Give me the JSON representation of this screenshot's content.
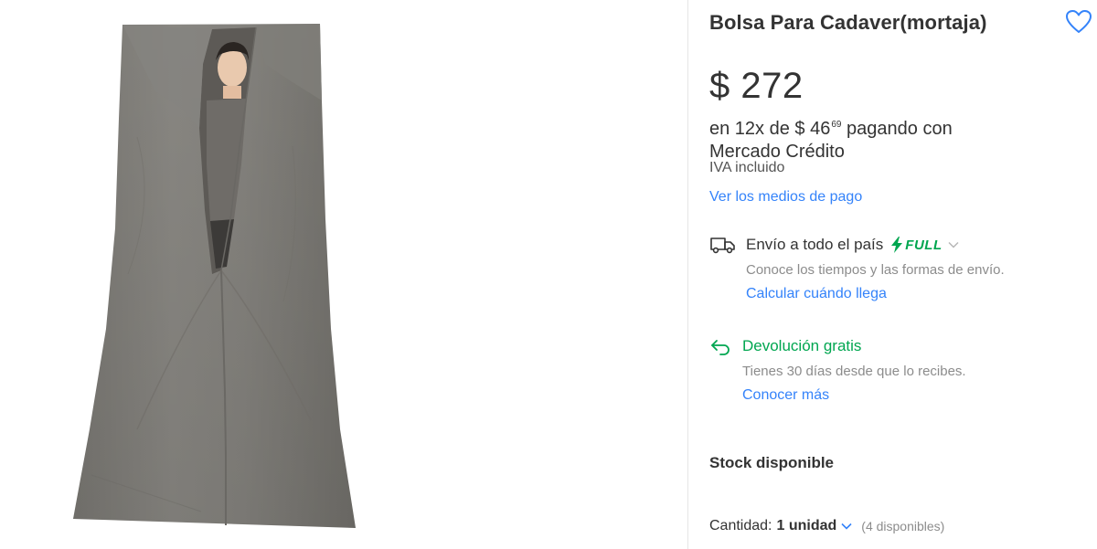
{
  "product": {
    "title": "Bolsa Para Cadaver(mortaja)",
    "image_icon": "body-bag-photo"
  },
  "price": {
    "currency": "$",
    "amount": "272",
    "display": "$ 272",
    "installments_prefix": "en 12x de $ 46",
    "installments_cents": "69",
    "installments_suffix": " pagando con",
    "installments_line2": "Mercado Crédito",
    "tax_note": "IVA incluido",
    "payment_link": "Ver los medios de pago"
  },
  "shipping": {
    "icon": "truck-icon",
    "label": "Envío a todo el país",
    "badge": "FULL",
    "badge_color": "#00a650",
    "description": "Conoce los tiempos y las formas de envío.",
    "link": "Calcular cuándo llega"
  },
  "returns": {
    "icon": "return-arrow-icon",
    "label": "Devolución gratis",
    "description": "Tienes 30 días desde que lo recibes.",
    "link": "Conocer más"
  },
  "stock": {
    "label": "Stock disponible",
    "quantity_label": "Cantidad:",
    "quantity_value": "1 unidad",
    "available": "(4 disponibles)"
  },
  "colors": {
    "link": "#3483fa",
    "green": "#00a650",
    "text": "#333333",
    "muted": "#8c8c8c"
  }
}
